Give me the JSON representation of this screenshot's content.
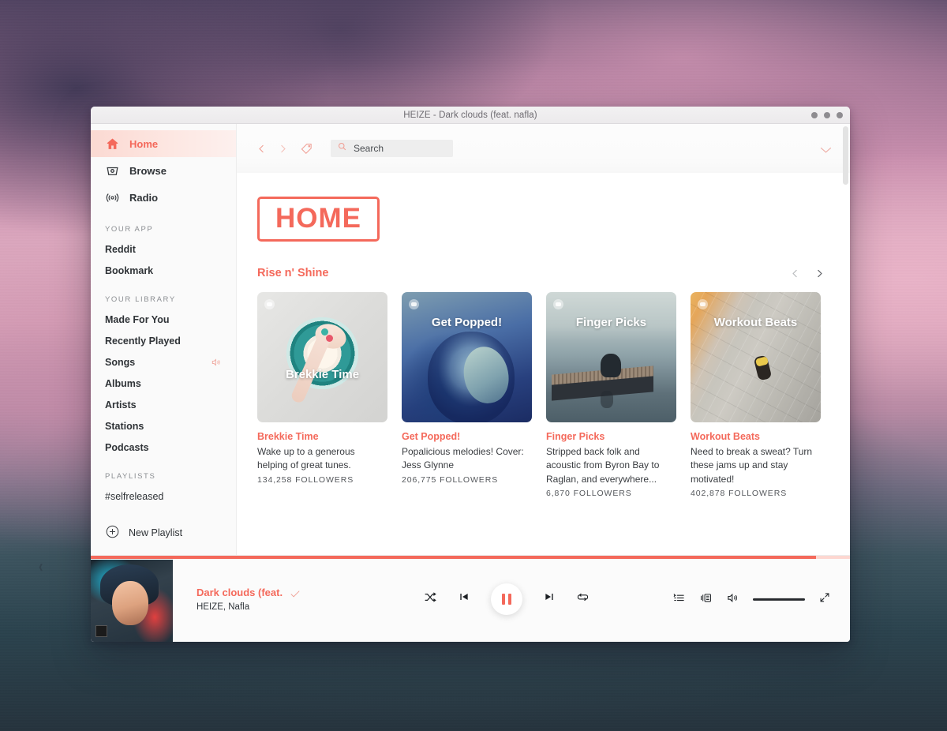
{
  "window": {
    "title": "HEIZE - Dark clouds (feat. nafla)",
    "accent": "#f4695b",
    "dots": [
      "minimize",
      "maximize",
      "close"
    ]
  },
  "sidebar": {
    "nav": [
      {
        "label": "Home",
        "icon": "home-icon",
        "active": true
      },
      {
        "label": "Browse",
        "icon": "browse-icon",
        "active": false
      },
      {
        "label": "Radio",
        "icon": "radio-icon",
        "active": false
      }
    ],
    "your_app": {
      "label": "YOUR APP",
      "items": [
        {
          "label": "Reddit"
        },
        {
          "label": "Bookmark"
        }
      ]
    },
    "your_library": {
      "label": "YOUR LIBRARY",
      "items": [
        {
          "label": "Made For You",
          "playing": false
        },
        {
          "label": "Recently Played",
          "playing": false
        },
        {
          "label": "Songs",
          "playing": true
        },
        {
          "label": "Albums",
          "playing": false
        },
        {
          "label": "Artists",
          "playing": false
        },
        {
          "label": "Stations",
          "playing": false
        },
        {
          "label": "Podcasts",
          "playing": false
        }
      ]
    },
    "playlists": {
      "label": "PLAYLISTS",
      "items": [
        {
          "label": "#selfreleased"
        }
      ]
    },
    "new_playlist": {
      "label": "New Playlist",
      "icon": "plus-circle-icon"
    }
  },
  "topbar": {
    "back_icon": "chevron-left-icon",
    "forward_icon": "chevron-right-icon",
    "tag_icon": "tag-icon",
    "search": {
      "placeholder": "Search",
      "value": "",
      "icon": "search-icon"
    },
    "dropdown_icon": "chevron-down-icon"
  },
  "content": {
    "page_badge": "HOME",
    "shelf": {
      "title": "Rise n' Shine",
      "prev_icon": "chevron-left-icon",
      "next_icon": "chevron-right-icon",
      "cards": [
        {
          "art_label": "Brekkie Time",
          "title": "Brekkie Time",
          "description": "Wake up to a generous helping of great tunes.",
          "followers": "134,258 FOLLOWERS",
          "art_label_top": "58%"
        },
        {
          "art_label": "Get Popped!",
          "title": "Get Popped!",
          "description": "Popalicious melodies! Cover: Jess Glynne",
          "followers": "206,775 FOLLOWERS",
          "art_label_top": "18%"
        },
        {
          "art_label": "Finger Picks",
          "title": "Finger Picks",
          "description": "Stripped back folk and acoustic from Byron Bay to Raglan, and everywhere...",
          "followers": "6,870 FOLLOWERS",
          "art_label_top": "18%"
        },
        {
          "art_label": "Workout Beats",
          "title": "Workout Beats",
          "description": "Need to break a sweat? Turn these jams up and stay motivated!",
          "followers": "402,878 FOLLOWERS",
          "art_label_top": "18%"
        }
      ]
    }
  },
  "player": {
    "progress_percent": 95,
    "track_title": "Dark clouds (feat.",
    "track_artist": "HEIZE, Nafla",
    "saved_icon": "check-icon",
    "controls": {
      "shuffle": "shuffle-icon",
      "previous": "skip-back-icon",
      "play_pause": "pause-icon",
      "next": "skip-forward-icon",
      "repeat": "repeat-icon"
    },
    "tools": {
      "queue": "queue-list-icon",
      "devices": "connect-device-icon",
      "volume": "volume-icon",
      "volume_level": 100,
      "fullscreen": "expand-icon"
    }
  }
}
